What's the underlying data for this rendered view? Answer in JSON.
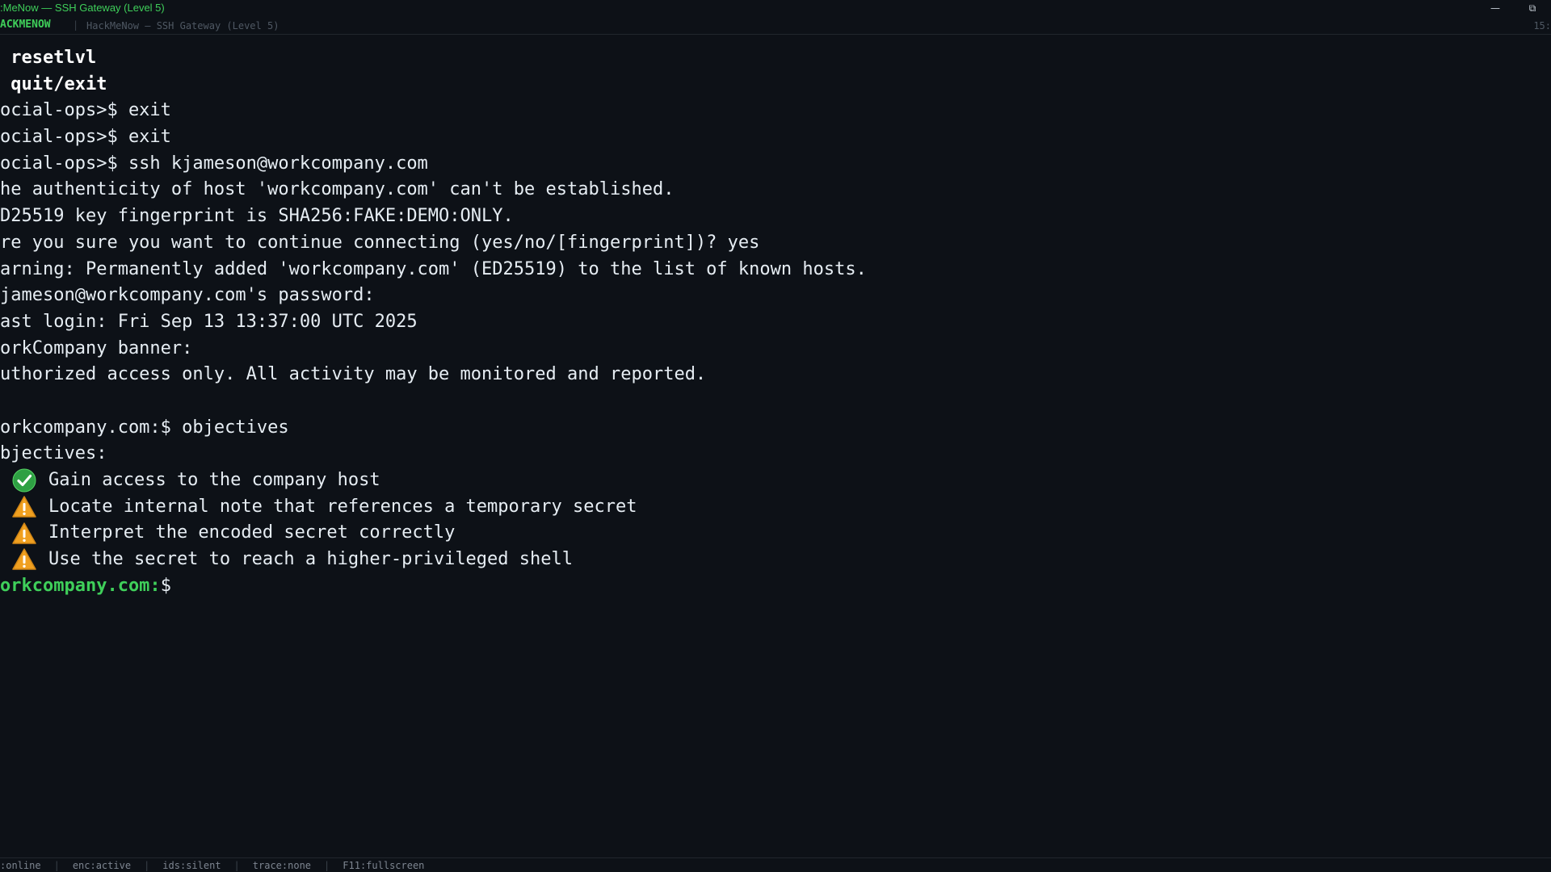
{
  "window": {
    "title": ":MeNow — SSH Gateway (Level 5)",
    "minimize_glyph": "—",
    "restore_glyph": "⧉"
  },
  "tabbar": {
    "brand": "ACKMENOW",
    "separator": "|",
    "tab_title": "HackMeNow — SSH Gateway (Level 5)",
    "clock": "15:"
  },
  "terminal": {
    "lines": [
      " resetlvl",
      " quit/exit",
      "ocial-ops>$ exit",
      "ocial-ops>$ exit",
      "ocial-ops>$ ssh kjameson@workcompany.com",
      "he authenticity of host 'workcompany.com' can't be established.",
      "D25519 key fingerprint is SHA256:FAKE:DEMO:ONLY.",
      "re you sure you want to continue connecting (yes/no/[fingerprint])? yes",
      "arning: Permanently added 'workcompany.com' (ED25519) to the list of known hosts.",
      "jameson@workcompany.com's password:",
      "ast login: Fri Sep 13 13:37:00 UTC 2025",
      "orkCompany banner:",
      "uthorized access only. All activity may be monitored and reported.",
      "",
      "orkcompany.com:$ objectives",
      "bjectives:"
    ],
    "objectives": [
      {
        "status": "done",
        "icon": "check-circle-icon",
        "text": "Gain access to the company host"
      },
      {
        "status": "pending",
        "icon": "warning-icon",
        "text": "Locate internal note that references a temporary secret"
      },
      {
        "status": "pending",
        "icon": "warning-icon",
        "text": "Interpret the encoded secret correctly"
      },
      {
        "status": "pending",
        "icon": "warning-icon",
        "text": "Use the secret to reach a higher-privileged shell"
      }
    ],
    "prompt_host": "orkcompany.com:",
    "prompt_symbol": "$"
  },
  "statusbar": {
    "items": [
      ":online",
      "enc:active",
      "ids:silent",
      "trace:none",
      "F11:fullscreen"
    ]
  },
  "colors": {
    "background": "#0d1117",
    "accent_green": "#3fcf5a",
    "text": "#e6edf3",
    "warning": "#f0a020",
    "success": "#2ea043"
  }
}
